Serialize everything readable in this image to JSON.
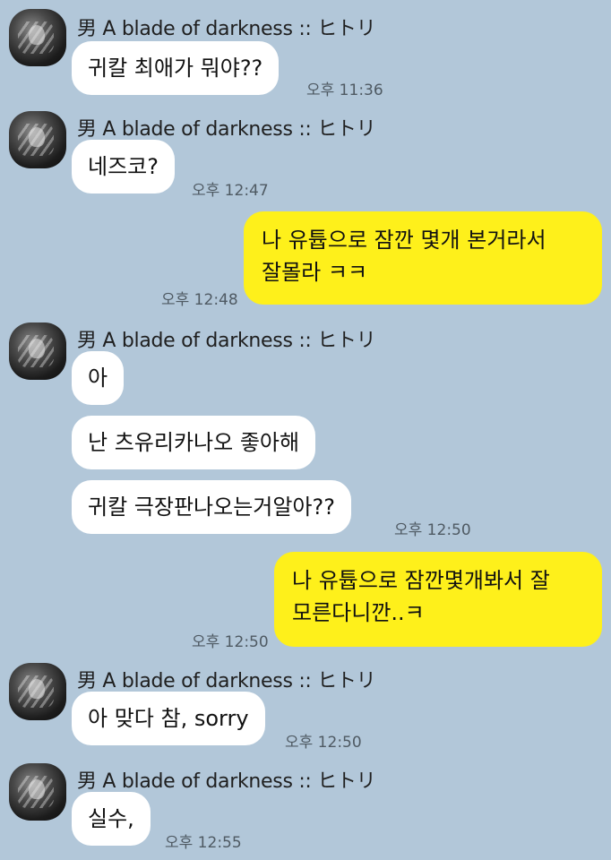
{
  "contact": {
    "name": "男 A blade of darkness :: ヒトリ"
  },
  "messages": [
    {
      "text": "귀칼 최애가 뭐야??",
      "time": "오후 11:36"
    },
    {
      "text": "네즈코?",
      "time": "오후 12:47"
    },
    {
      "line1": "나 유튭으로 잠깐 몇개 본거라서",
      "line2": "잘몰라 ㅋㅋ",
      "time": "오후 12:48"
    },
    {
      "text": "아"
    },
    {
      "text": "난 츠유리카나오 좋아해"
    },
    {
      "text": "귀칼 극장판나오는거알아??",
      "time": "오후 12:50"
    },
    {
      "line1": "나 유튭으로 잠깐몇개봐서 잘",
      "line2": "모른다니깐..ㅋ",
      "time": "오후 12:50"
    },
    {
      "text": "아 맞다 참, sorry",
      "time": "오후 12:50"
    },
    {
      "text": "실수,",
      "time": "오후 12:55"
    }
  ],
  "colors": {
    "background": "#b2c7d9",
    "incoming_bubble": "#ffffff",
    "outgoing_bubble": "#fef01b"
  }
}
